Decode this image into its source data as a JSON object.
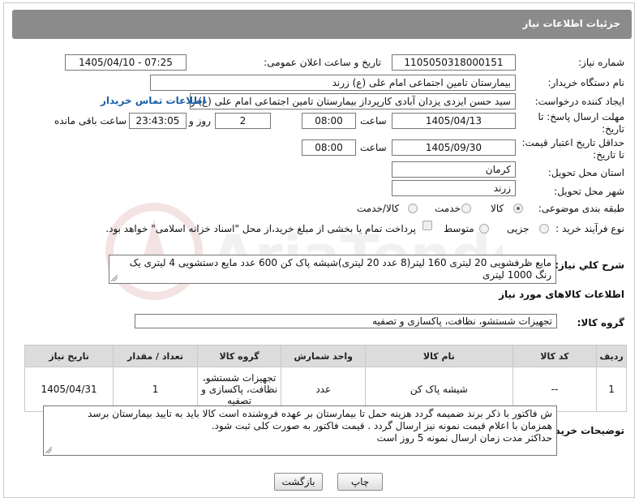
{
  "header": {
    "title": "جزئیات اطلاعات نیاز"
  },
  "fields": {
    "need_number_label": "شماره نیاز:",
    "need_number": "1105050318000151",
    "announce_label": "تاریخ و ساعت اعلان عمومی:",
    "announce_value": "1405/04/10 - 07:25",
    "buyer_org_label": "نام دستگاه خریدار:",
    "buyer_org": "بیمارستان تامین اجتماعی امام علی (ع) زرند",
    "creator_label": "ایجاد کننده درخواست:",
    "creator": "سید حسن ایزدی یزدان آبادی کارپرداز بیمارستان تامین اجتماعی امام علی (ع) ز",
    "contact_link": "اطلاعات تماس خریدار",
    "reply_deadline_label_1": "مهلت ارسال پاسخ: تا",
    "reply_deadline_label_2": "تاریخ:",
    "reply_date": "1405/04/13",
    "time_label": "ساعت",
    "reply_time": "08:00",
    "days_count": "2",
    "days_label": "روز و",
    "remaining_time": "23:43:05",
    "remaining_label": "ساعت باقی مانده",
    "price_deadline_label_1": "حداقل تاریخ اعتبار قیمت:",
    "price_deadline_label_2": "تا تاریخ:",
    "price_date": "1405/09/30",
    "price_time": "08:00",
    "province_label": "استان محل تحویل:",
    "province": "کرمان",
    "city_label": "شهر محل تحویل:",
    "city": "زرند",
    "category_label": "طبقه بندی موضوعی:",
    "category_options": [
      "کالا",
      "خدمت",
      "کالا/خدمت"
    ],
    "purchase_type_label": "نوع فرآیند خرید :",
    "purchase_options": [
      "جزیی",
      "متوسط"
    ],
    "payment_note": "پرداخت تمام یا بخشی از مبلغ خرید،از محل \"اسناد خزانه اسلامی\" خواهد بود."
  },
  "summary": {
    "label": "شرح کلي نياز:",
    "text": "مایع ظرفشویی 20 لیتری 160 لیتر(8 عدد 20 لیتری)شیشه پاک کن 600 عدد   مایع دستشویی 4 لیتری یک رنگ 1000 لیتری"
  },
  "goods": {
    "section_title": "اطلاعات کالاهای مورد نیاز",
    "group_label": "گروه کالا:",
    "group_value": "تجهیزات شستشو، نظافت، پاکسازی و تصفیه",
    "columns": [
      "ردیف",
      "کد کالا",
      "نام کالا",
      "واحد شمارش",
      "گروه کالا",
      "تعداد / مقدار",
      "تاریخ نیاز"
    ],
    "rows": [
      {
        "row": "1",
        "code": "--",
        "name": "شیشه پاک کن",
        "unit": "عدد",
        "group_l1": "تجهیزات شستشو،",
        "group_l2": "نظافت، پاکسازی و",
        "group_l3": "تصفیه",
        "qty": "1",
        "date": "1405/04/31"
      }
    ]
  },
  "notes": {
    "label": "توضیحات خریدار:",
    "line1": "ش فاکتور با ذکر برند ضمیمه گردد هزینه حمل تا بیمارستان بر عهده فروشنده است کالا باید به تایید بیمارستان برسد",
    "line2": "همزمان با اعلام قیمت نمونه نیز ارسال گردد . قیمت فاکتور به صورت کلی ثبت شود.",
    "line3": "حداکثر مدت زمان ارسال نمونه 5 روز است"
  },
  "buttons": {
    "print": "چاپ",
    "back": "بازگشت"
  },
  "watermark": {
    "text": "AriaTender.neT"
  }
}
